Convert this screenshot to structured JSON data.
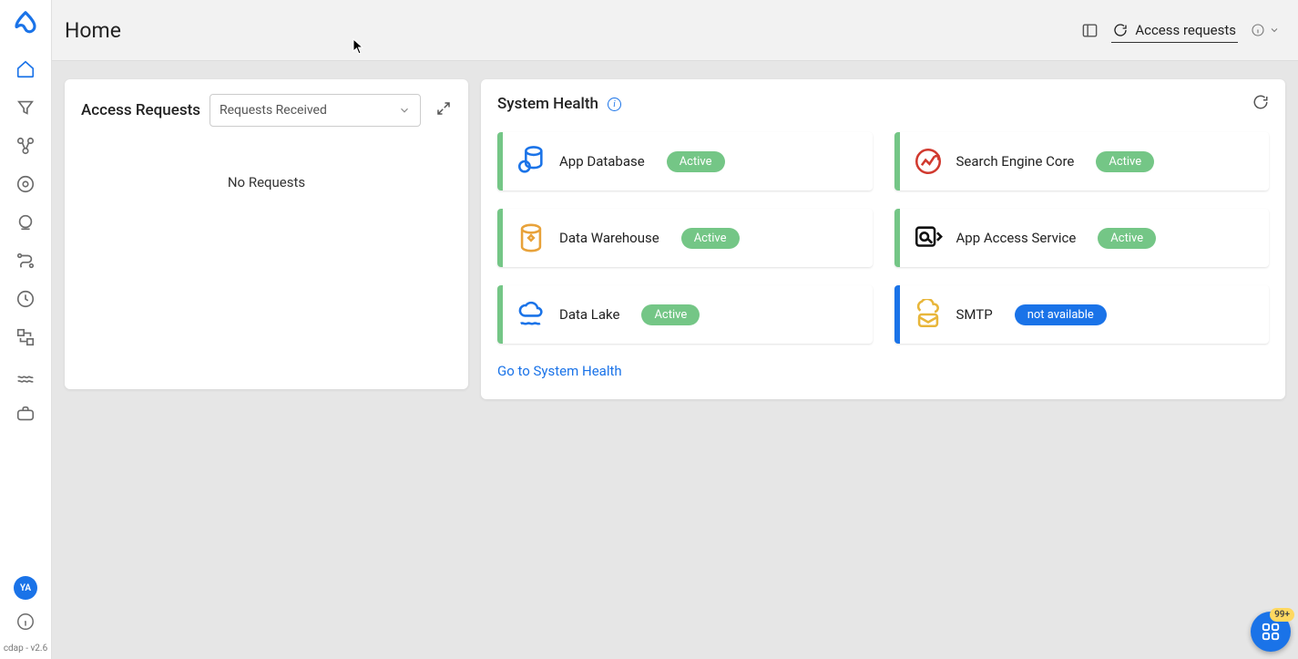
{
  "sidebar": {
    "avatar_initials": "YA",
    "version_label": "cdap - v2.6"
  },
  "header": {
    "title": "Home",
    "access_requests_label": "Access requests"
  },
  "access_requests_panel": {
    "title": "Access Requests",
    "dropdown_selected": "Requests Received",
    "empty_message": "No Requests"
  },
  "system_health_panel": {
    "title": "System Health",
    "go_link": "Go to System Health",
    "items": [
      {
        "name": "App Database",
        "status": "Active",
        "status_class": "active",
        "bar": "green",
        "icon_color": "#1a73e8"
      },
      {
        "name": "Search Engine Core",
        "status": "Active",
        "status_class": "active",
        "bar": "green",
        "icon_color": "#d13a2f"
      },
      {
        "name": "Data Warehouse",
        "status": "Active",
        "status_class": "active",
        "bar": "green",
        "icon_color": "#e8a23a"
      },
      {
        "name": "App Access Service",
        "status": "Active",
        "status_class": "active",
        "bar": "green",
        "icon_color": "#111"
      },
      {
        "name": "Data Lake",
        "status": "Active",
        "status_class": "active",
        "bar": "green",
        "icon_color": "#1a73e8"
      },
      {
        "name": "SMTP",
        "status": "not available",
        "status_class": "na",
        "bar": "blue",
        "icon_color": "#e8b63a"
      }
    ]
  },
  "fab": {
    "badge": "99+"
  }
}
